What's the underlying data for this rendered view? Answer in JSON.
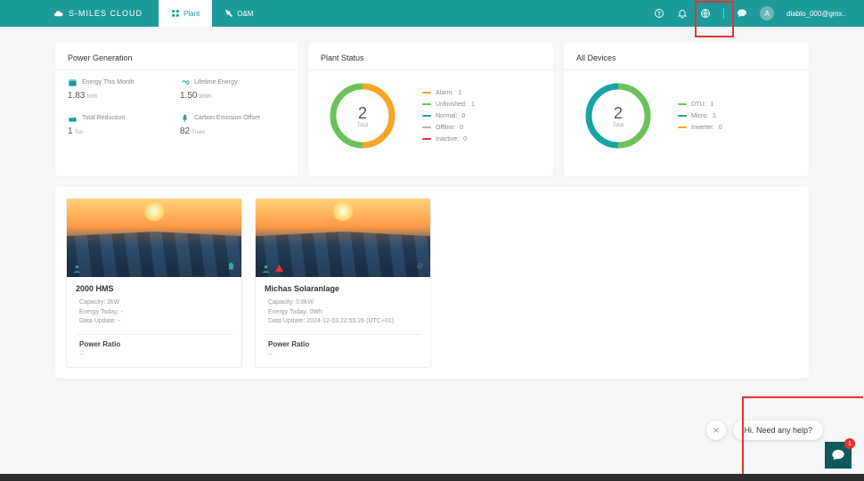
{
  "brand": "S-MILES CLOUD",
  "tabs": {
    "plant": "Plant",
    "oam": "O&M"
  },
  "header": {
    "avatar_letter": "A",
    "username": "diablo_000@gmx.."
  },
  "power_generation": {
    "title": "Power Generation",
    "month_label": "Energy This Month",
    "month_value": "1.83",
    "month_unit": "kWh",
    "lifetime_label": "Lifetime Energy",
    "lifetime_value": "1.50",
    "lifetime_unit": "MWh",
    "reduction_label": "Total Reduction",
    "reduction_value": "1",
    "reduction_unit": "Ton",
    "offset_label": "Carbon Emission Offset",
    "offset_value": "82",
    "offset_unit": "Trees"
  },
  "plant_status": {
    "title": "Plant Status",
    "total": "2",
    "total_label": "Total",
    "legend": {
      "alarm_label": "Alarm:",
      "alarm_value": "1",
      "unfinished_label": "Unfinished:",
      "unfinished_value": "1",
      "normal_label": "Normal:",
      "normal_value": "0",
      "offline_label": "Offline:",
      "offline_value": "0",
      "inactive_label": "Inactive:",
      "inactive_value": "0"
    }
  },
  "all_devices": {
    "title": "All Devices",
    "total": "2",
    "total_label": "Total",
    "legend": {
      "dtu_label": "DTU:",
      "dtu_value": "1",
      "micro_label": "Micro:",
      "micro_value": "1",
      "inverter_label": "Inverter:",
      "inverter_value": "0"
    }
  },
  "plants": {
    "p1": {
      "name": "2000 HMS",
      "capacity": "Capacity: 2kW",
      "energy": "Energy Today: -",
      "update": "Data Update: -",
      "ratio_label": "Power Ratio",
      "ratio_value": "--"
    },
    "p2": {
      "name": "Michas Solaranlage",
      "capacity": "Capacity: 0.8kW",
      "energy": "Energy Today: 0Wh",
      "update": "Data Update: 2024-12-03 22:55:26 (UTC+01)",
      "ratio_label": "Power Ratio",
      "ratio_value": "--"
    }
  },
  "chat": {
    "text": "Hi. Need any help?",
    "badge": "1"
  },
  "colors": {
    "orange": "#f5a623",
    "green": "#6bc25a",
    "teal": "#16a4a4",
    "gray": "#b0b0b0",
    "red": "#e63232"
  },
  "chart_data": [
    {
      "type": "pie",
      "title": "Plant Status",
      "categories": [
        "Alarm",
        "Unfinished",
        "Normal",
        "Offline",
        "Inactive"
      ],
      "values": [
        1,
        1,
        0,
        0,
        0
      ],
      "colors": [
        "#f5a623",
        "#6bc25a",
        "#16a4a4",
        "#b0b0b0",
        "#e63232"
      ],
      "total": 2
    },
    {
      "type": "pie",
      "title": "All Devices",
      "categories": [
        "DTU",
        "Micro",
        "Inverter"
      ],
      "values": [
        1,
        1,
        0
      ],
      "colors": [
        "#6bc25a",
        "#16a4a4",
        "#f5a623"
      ],
      "total": 2
    }
  ]
}
